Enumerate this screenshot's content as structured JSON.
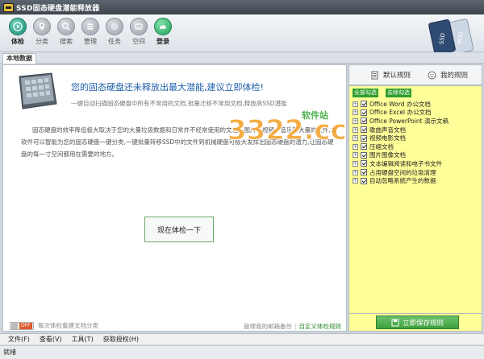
{
  "window": {
    "title": "SSD固态硬盘潜能释放器"
  },
  "toolbar": {
    "items": [
      {
        "label": "体检",
        "icon": "play-icon"
      },
      {
        "label": "分类",
        "icon": "pin-icon"
      },
      {
        "label": "搜索",
        "icon": "search-icon"
      },
      {
        "label": "管理",
        "icon": "list-icon"
      },
      {
        "label": "任务",
        "icon": "gear-icon"
      },
      {
        "label": "空间",
        "icon": "disk-icon"
      },
      {
        "label": "登录",
        "icon": "cloud-icon"
      }
    ]
  },
  "tabs": {
    "local_data": "本地数据"
  },
  "main": {
    "headline": "您的固态硬盘还未释放出最大潜能,建议立即体检!",
    "subline": "一键自动扫描固态硬盘中所有不常用的文档,批量迁移不常用文档,释放高SSD潜能",
    "description": "固态硬盘的效率降低极大取决于您的大量垃圾数据和日常并不经常使用的文档、图片、视频、音乐等大量的文件,本软件可以智能为您的固态硬盘一键分类,一键批量转移SSD中的文件到机械硬盘可极大发挥出固态硬盘的潜力,让固态硬盘的每一寸空间都用在需要的地方。",
    "checkup_button": "现在体检一下",
    "watermark_text": "3322.cc",
    "watermark_sub": "软件站",
    "toggle_state": "OFF",
    "toggle_label": "每次体检重建文档分类",
    "footer_manage": "管理我的邮箱备份",
    "footer_custom": "自定义体检规则"
  },
  "right_panel": {
    "tab_default": "默认规则",
    "tab_mine": "我的规则",
    "select_all": "全部勾选",
    "deselect_all": "去除勾选",
    "rules": [
      "Office Word 办公文档",
      "Office Excel 办公文档",
      "Office PowerPoint 演示文稿",
      "歌曲声音文档",
      "视频电影文档",
      "压缩文档",
      "图片图像文档",
      "文本编辑阅读和电子书文件",
      "占用硬盘空间的垃圾清理",
      "自动忽略系统产生的数据"
    ],
    "save_button": "立即保存规则"
  },
  "menubar": {
    "items": [
      "文件(F)",
      "查看(V)",
      "工具(T)",
      "获取授权(H)"
    ]
  },
  "status": {
    "text": "就绪"
  },
  "colors": {
    "accent_green": "#3c9f3c",
    "headline_blue": "#1d5fa8",
    "rules_bg": "#ffff99"
  }
}
